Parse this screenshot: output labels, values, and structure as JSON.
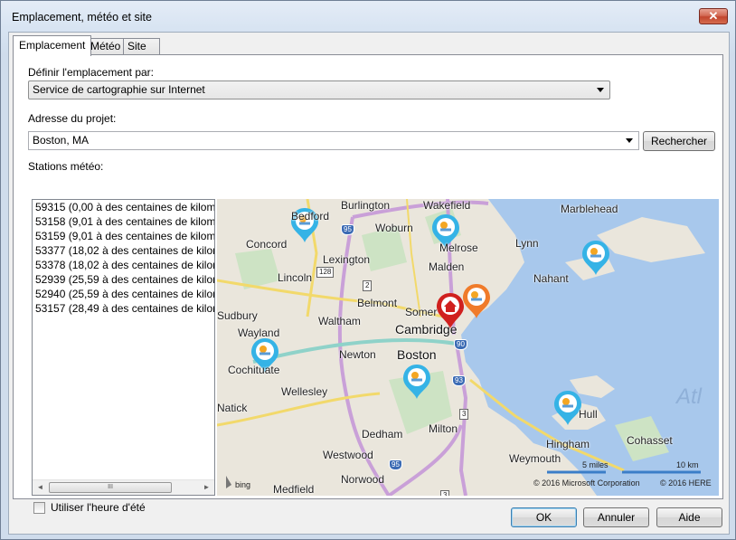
{
  "window": {
    "title": "Emplacement, météo et site",
    "close_label": "✕"
  },
  "tabs": [
    {
      "label": "Emplacement"
    },
    {
      "label": "Météo"
    },
    {
      "label": "Site"
    }
  ],
  "location": {
    "define_label": "Définir l'emplacement par:",
    "define_value": "Service de cartographie sur Internet",
    "address_label": "Adresse du projet:",
    "address_value": "Boston, MA",
    "search_button": "Rechercher",
    "stations_label": "Stations météo:"
  },
  "stations": [
    "59315 (0,00 à des centaines de kilom",
    "53158 (9,01 à des centaines de kilom",
    "53159 (9,01 à des centaines de kilom",
    "53377 (18,02 à des centaines de kilor",
    "53378 (18,02 à des centaines de kilor",
    "52939 (25,59 à des centaines de kilor",
    "52940 (25,59 à des centaines de kilor",
    "53157 (28,49 à des centaines de kilor"
  ],
  "scrollbar": {
    "thumb_grip": "III",
    "left_arrow": "◄",
    "right_arrow": "►"
  },
  "map": {
    "places": {
      "bedford": "Bedford",
      "burlington": "Burlington",
      "wakefield": "Wakefield",
      "marblehead": "Marblehead",
      "woburn": "Woburn",
      "melrose": "Melrose",
      "concord": "Concord",
      "lexington": "Lexington",
      "lynn": "Lynn",
      "malden": "Malden",
      "nahant": "Nahant",
      "lincoln": "Lincoln",
      "belmont": "Belmont",
      "somerville": "Somer",
      "waltham": "Waltham",
      "sudbury": "Sudbury",
      "cambridge": "Cambridge",
      "wayland": "Wayland",
      "newton": "Newton",
      "boston": "Boston",
      "cochituate": "Cochituate",
      "wellesley": "Wellesley",
      "atlantic": "Atl",
      "hull": "Hull",
      "milton": "Milton",
      "hingham": "Hingham",
      "cohasset": "Cohasset",
      "dedham": "Dedham",
      "westwood": "Westwood",
      "weymouth": "Weymouth",
      "medfield": "Medfield",
      "norwood": "Norwood",
      "natick": "Natick"
    },
    "routes": [
      "95",
      "128",
      "2",
      "90",
      "93",
      "3",
      "95",
      "3"
    ],
    "scale_miles": "5 miles",
    "scale_km": "10 km",
    "copyright": "© 2016 Microsoft Corporation",
    "copyright_right": "© 2016 HERE",
    "bing_label": "bing",
    "colors": {
      "water": "#a8c8ec",
      "land": "#eae6dc",
      "highway": "#c9a0d8",
      "primary": "#f7e98f",
      "pin_weather": "#35b3e6",
      "pin_orange": "#f07b2a",
      "pin_home": "#d0201e"
    }
  },
  "dst_label": "Utiliser l'heure d'été",
  "buttons": {
    "ok": "OK",
    "cancel": "Annuler",
    "help": "Aide"
  }
}
